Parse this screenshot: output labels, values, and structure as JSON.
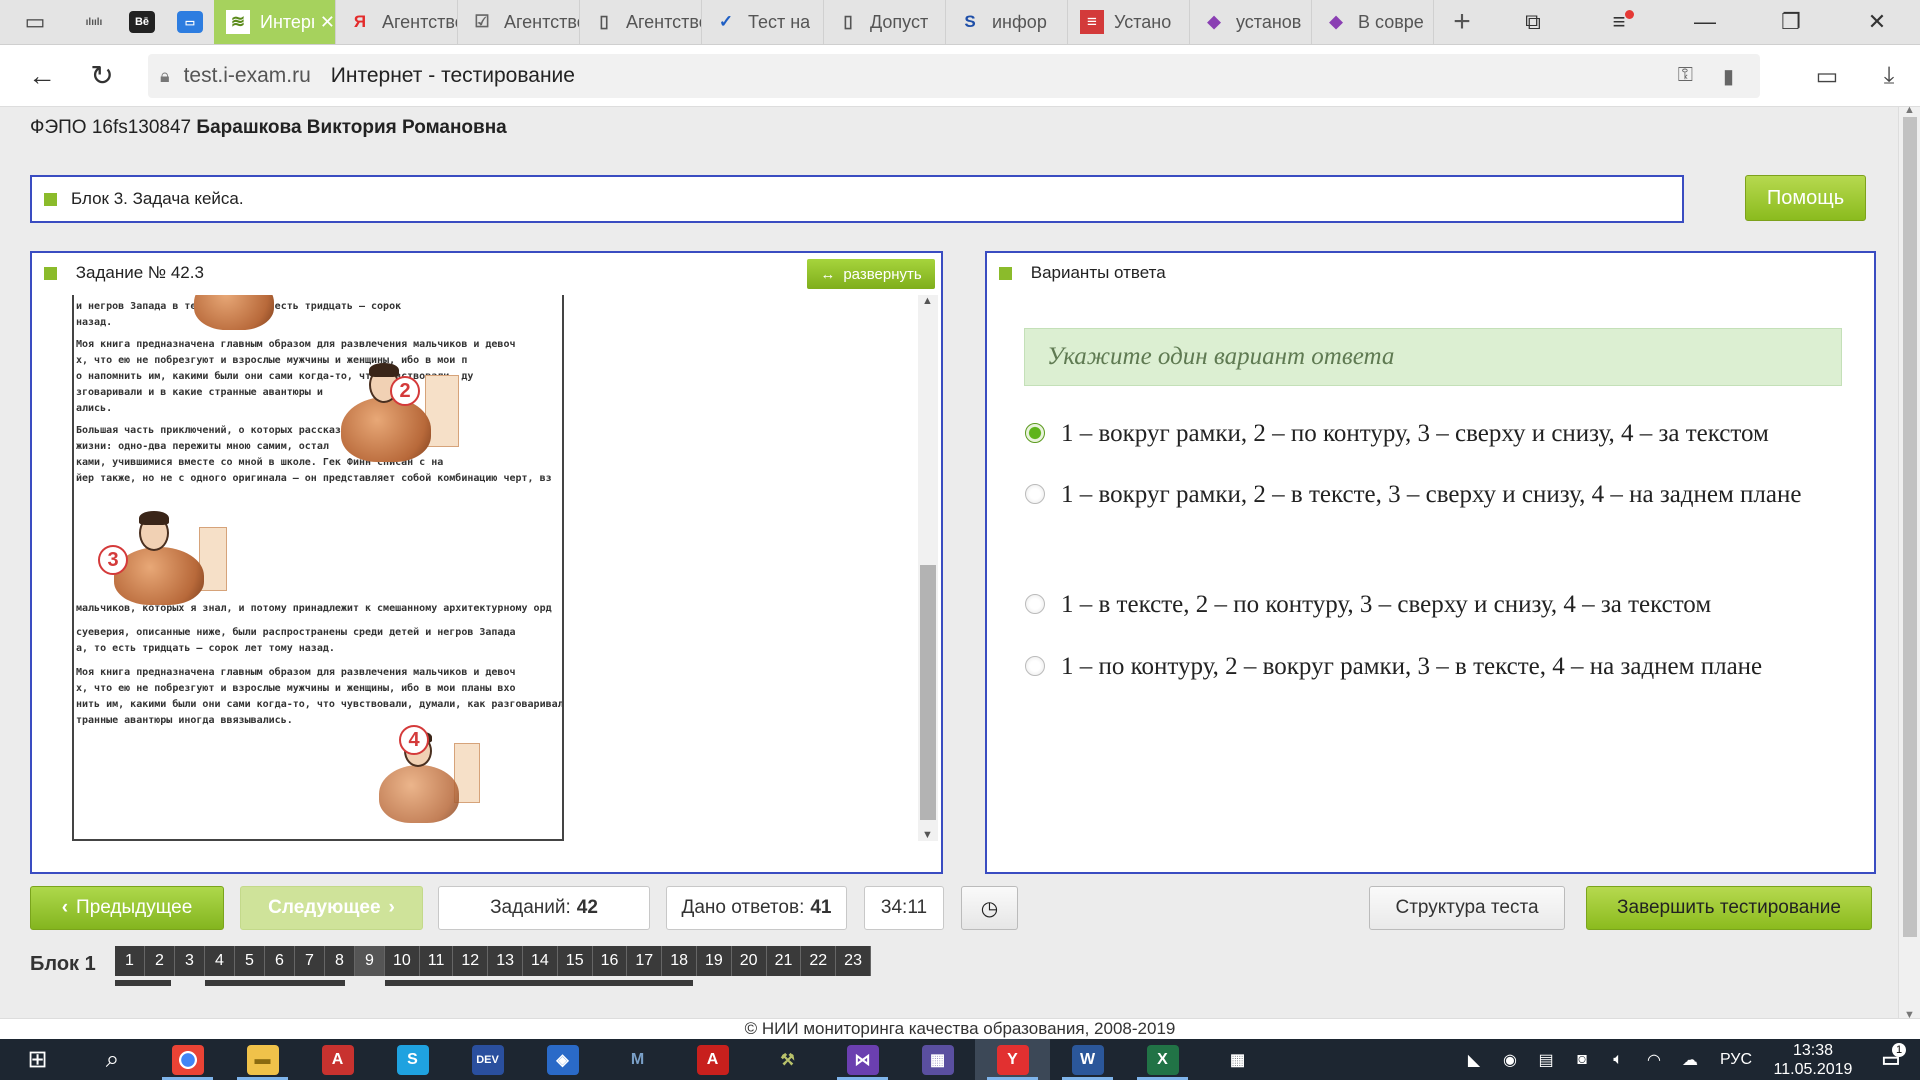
{
  "browser": {
    "tabs": [
      {
        "label": "Интернет - тестирование",
        "icon": "exam-icon",
        "active": true
      },
      {
        "label": "Агентство",
        "icon": "yandex-icon",
        "active": false
      },
      {
        "label": "Агентство",
        "icon": "checkbox-icon",
        "active": false
      },
      {
        "label": "Агентство",
        "icon": "document-icon",
        "active": false
      },
      {
        "label": "Тест на",
        "icon": "check-icon",
        "active": false
      },
      {
        "label": "Допуст",
        "icon": "document-icon",
        "active": false
      },
      {
        "label": "инфор",
        "icon": "s-icon",
        "active": false
      },
      {
        "label": "Устано",
        "icon": "red-icon",
        "active": false
      },
      {
        "label": "установ",
        "icon": "purple-icon",
        "active": false
      },
      {
        "label": "В совре",
        "icon": "purple-icon",
        "active": false
      }
    ],
    "pinned": [
      {
        "icon": "cisco-icon",
        "text": "cisco"
      },
      {
        "icon": "behance-icon",
        "text": "Bē"
      },
      {
        "icon": "chat-icon",
        "text": ""
      }
    ],
    "url_domain": "test.i-exam.ru",
    "url_title": "Интернет - тестирование"
  },
  "header": {
    "prefix": "ФЭПО 16fs130847",
    "student": "Барашкова Виктория Романовна"
  },
  "block": {
    "title": "Блок 3. Задача кейса.",
    "help_label": "Помощь"
  },
  "task": {
    "title": "Задание № 42.3",
    "expand_label": "развернуть",
    "doc_lines": [
      "и    негров                          Запада в те времена, то есть тридцать — сорок",
      "назад.",
      "Моя книга предназначена главным образом для развлечения мальчиков и девоч",
      "х, что ею не побрезгуют и взрослые мужчины и        женщины, ибо в мои п",
      "о напомнить им, какими были они сами когда-то,          что чувствовали, ду",
      "зговаривали и в какие странные авантюры                                 и",
      "ались.",
      "Большая часть приключений, о которых рассказано в                этой книге,",
      "жизни: одно-два пережиты мною самим,                              остал",
      "ками, учившимися вместе со мной в школе. Гек Финн            списан с на",
      "йер также, но не с одного оригинала — он представляет собой комбинацию черт, вз",
      "мальчиков, которых я знал, и потому принадлежит к смешанному архитектурному орд",
      "суеверия, описанные ниже, были распространены среди детей и негров Запада",
      "а, то есть тридцать — сорок лет тому назад.",
      "Моя книга предназначена главным образом для развлечения мальчиков и девоч",
      "х, что ею не побрезгуют и взрослые мужчины и женщины, ибо в мои планы вхо",
      "нить им, какими были они сами когда-то, что чувствовали, думали, как разговаривал",
      "транные авантюры иногда ввязывались."
    ],
    "figure_numbers": [
      "2",
      "3",
      "4"
    ]
  },
  "answers": {
    "title": "Варианты ответа",
    "instruction": "Укажите один вариант ответа",
    "options": [
      {
        "text": "1 – вокруг рамки, 2 – по контуру, 3 – сверху и снизу, 4 – за текстом",
        "selected": true
      },
      {
        "text": "1 – вокруг рамки, 2 – в тексте, 3 – сверху и снизу, 4 – на заднем плане",
        "selected": false
      },
      {
        "text": "1 – в тексте, 2 – по контуру, 3 – сверху и снизу, 4 – за текстом",
        "selected": false
      },
      {
        "text": "1 – по контуру, 2 – вокруг рамки, 3 – в тексте, 4 – на заднем плане",
        "selected": false
      }
    ]
  },
  "controls": {
    "prev_label": "Предыдущее",
    "next_label": "Следующее",
    "tasks_label": "Заданий:",
    "tasks_value": "42",
    "answered_label": "Дано ответов:",
    "answered_value": "41",
    "timer": "34:11",
    "structure_label": "Структура теста",
    "finish_label": "Завершить тестирование"
  },
  "navigator": {
    "block_label": "Блок 1",
    "numbers": [
      "1",
      "2",
      "3",
      "4",
      "5",
      "6",
      "7",
      "8",
      "9",
      "10",
      "11",
      "12",
      "13",
      "14",
      "15",
      "16",
      "17",
      "18",
      "19",
      "20",
      "21",
      "22",
      "23"
    ],
    "current": "9"
  },
  "footer": "© НИИ мониторинга качества образования, 2008-2019",
  "taskbar": {
    "language": "РУС",
    "time": "13:38",
    "date": "11.05.2019",
    "notifications": "1",
    "apps": [
      {
        "name": "chrome",
        "icon": "chrome-icon"
      },
      {
        "name": "explorer",
        "icon": "folder-icon"
      },
      {
        "name": "autocad",
        "icon": "autocad-icon"
      },
      {
        "name": "skype",
        "icon": "skype-icon",
        "text": "S"
      },
      {
        "name": "devcpp",
        "icon": "devcpp-icon",
        "text": "DEV"
      },
      {
        "name": "app",
        "icon": "app-icon"
      },
      {
        "name": "m",
        "icon": "m-icon",
        "text": "M"
      },
      {
        "name": "acrobat",
        "icon": "acrobat-icon",
        "text": "A"
      },
      {
        "name": "tool",
        "icon": "tool-icon"
      },
      {
        "name": "vs",
        "icon": "visualstudio-icon"
      },
      {
        "name": "app2",
        "icon": "app2-icon"
      },
      {
        "name": "yandex",
        "icon": "yandex-browser-icon",
        "text": "Y"
      },
      {
        "name": "word",
        "icon": "word-icon",
        "text": "W"
      },
      {
        "name": "excel",
        "icon": "excel-icon",
        "text": "X"
      },
      {
        "name": "calc",
        "icon": "calculator-icon"
      }
    ]
  }
}
